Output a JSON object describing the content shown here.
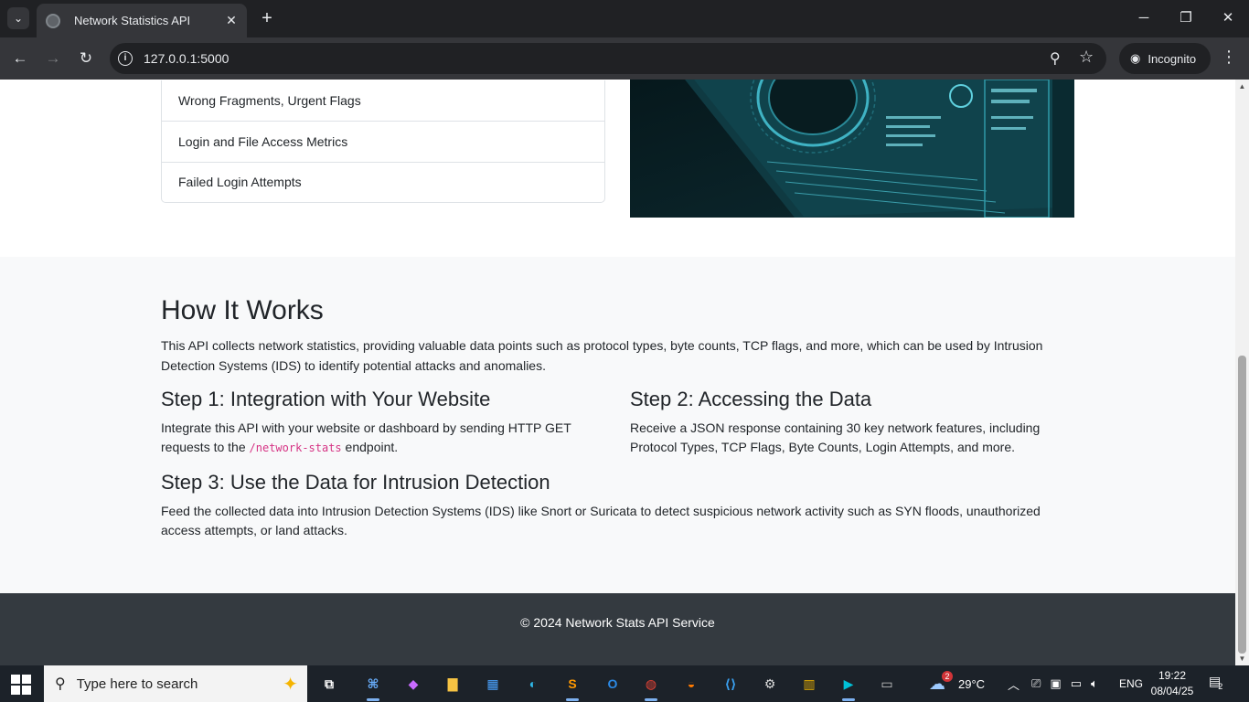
{
  "browser": {
    "tab_title": "Network Statistics API",
    "url": "127.0.0.1:5000",
    "incognito_label": "Incognito"
  },
  "page": {
    "list_items": [
      "Wrong Fragments, Urgent Flags",
      "Login and File Access Metrics",
      "Failed Login Attempts"
    ],
    "how": {
      "title": "How It Works",
      "intro": "This API collects network statistics, providing valuable data points such as protocol types, byte counts, TCP flags, and more, which can be used by Intrusion Detection Systems (IDS) to identify potential attacks and anomalies.",
      "step1_title": "Step 1: Integration with Your Website",
      "step1_text_a": "Integrate this API with your website or dashboard by sending HTTP GET requests to the ",
      "step1_code": "/network-stats",
      "step1_text_b": " endpoint.",
      "step2_title": "Step 2: Accessing the Data",
      "step2_text": "Receive a JSON response containing 30 key network features, including Protocol Types, TCP Flags, Byte Counts, Login Attempts, and more.",
      "step3_title": "Step 3: Use the Data for Intrusion Detection",
      "step3_text": "Feed the collected data into Intrusion Detection Systems (IDS) like Snort or Suricata to detect suspicious network activity such as SYN floods, unauthorized access attempts, or land attacks."
    },
    "footer": "© 2024 Network Stats API Service"
  },
  "taskbar": {
    "search_placeholder": "Type here to search",
    "weather": "29°C",
    "weather_badge": "2",
    "lang": "ENG",
    "time": "19:22",
    "date": "08/04/25",
    "notif_count": "2"
  }
}
